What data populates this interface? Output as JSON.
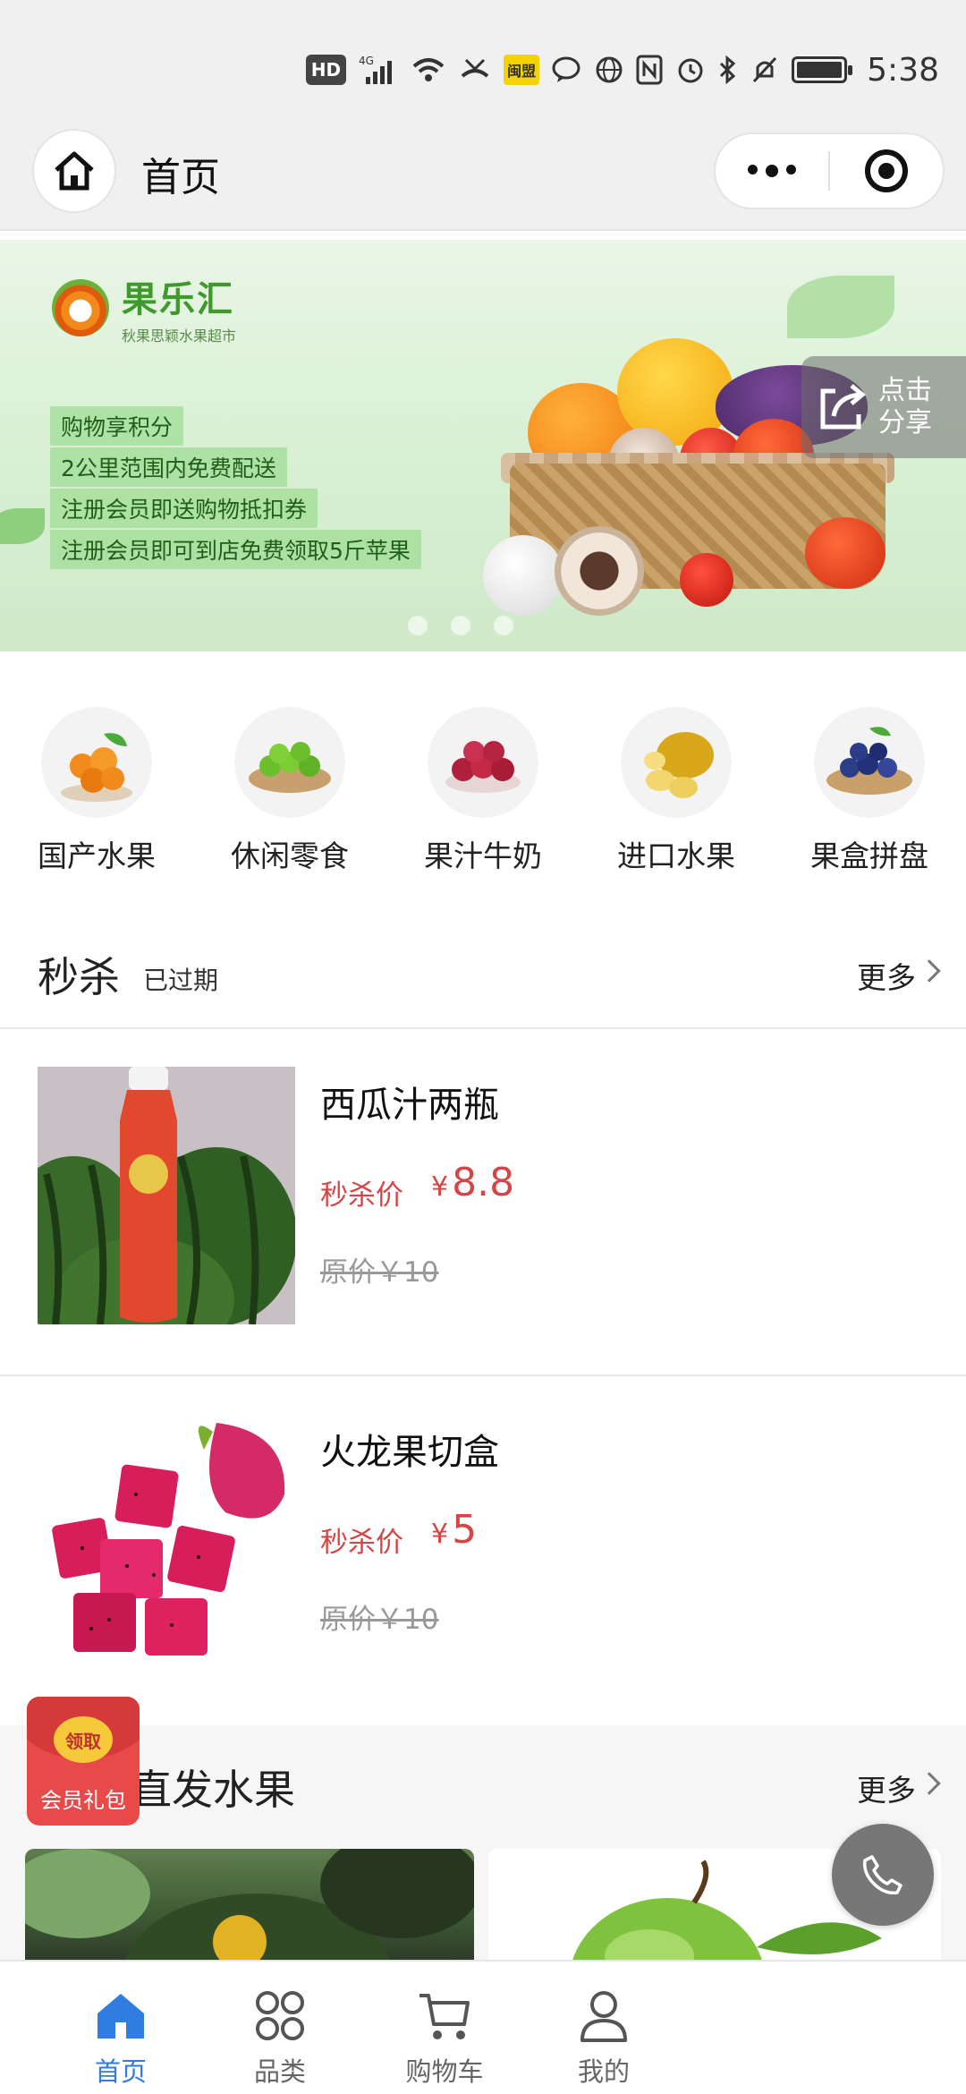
{
  "status_bar": {
    "hd": "HD",
    "net": "4G",
    "carrier_badge": "闽盟",
    "time": "5:38"
  },
  "nav": {
    "title": "首页"
  },
  "banner": {
    "logo_title": "果乐汇",
    "logo_subtitle": "秋果思颖水果超市",
    "promos": [
      "购物享积分",
      "2公里范围内免费配送",
      "注册会员即送购物抵扣券",
      "注册会员即可到店免费领取5斤苹果"
    ],
    "share_label": "点击分享",
    "slides": 3
  },
  "categories": [
    {
      "label": "国产水果",
      "icon": "loquat-icon"
    },
    {
      "label": "休闲零食",
      "icon": "green-plum-icon"
    },
    {
      "label": "果汁牛奶",
      "icon": "bayberry-icon"
    },
    {
      "label": "进口水果",
      "icon": "durian-icon"
    },
    {
      "label": "果盒拼盘",
      "icon": "blueberry-icon"
    }
  ],
  "flash_sale": {
    "title": "秒杀",
    "status": "已过期",
    "more": "更多",
    "products": [
      {
        "name": "西瓜汁两瓶",
        "sale_label": "秒杀价",
        "currency": "¥",
        "price": "8.8",
        "original": "原价￥10"
      },
      {
        "name": "火龙果切盒",
        "sale_label": "秒杀价",
        "currency": "¥",
        "price": "5",
        "original": "原价￥10"
      }
    ]
  },
  "direct": {
    "title": "直发水果",
    "more": "更多"
  },
  "gift": {
    "button": "领取",
    "label": "会员礼包"
  },
  "tabbar": [
    {
      "label": "首页",
      "icon": "home-icon",
      "active": true
    },
    {
      "label": "品类",
      "icon": "category-icon",
      "active": false
    },
    {
      "label": "购物车",
      "icon": "cart-icon",
      "active": false
    },
    {
      "label": "我的",
      "icon": "user-icon",
      "active": false
    }
  ],
  "colors": {
    "accent": "#2f7de1",
    "price": "#d64545",
    "brand_green": "#3f9a2c"
  }
}
